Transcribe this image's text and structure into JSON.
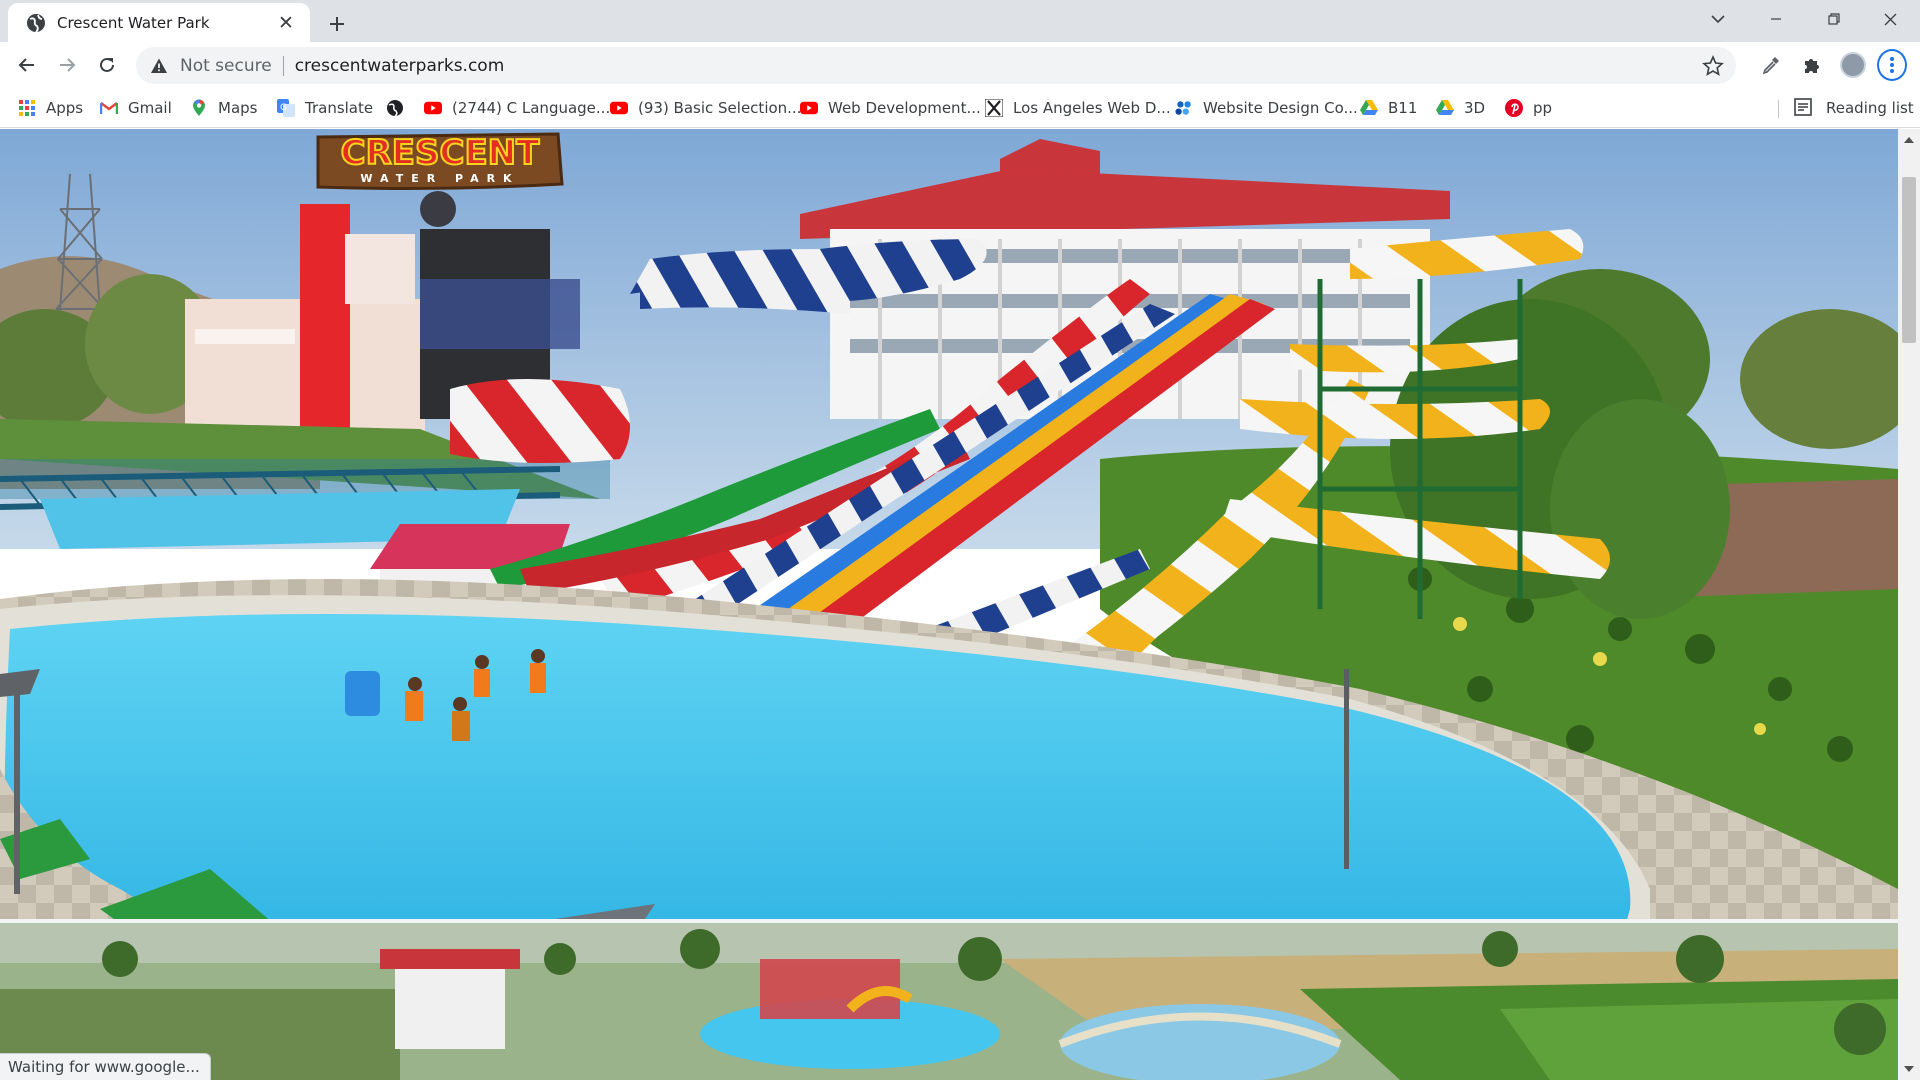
{
  "window": {
    "tab_title": "Crescent Water Park",
    "controls": [
      "tab-search",
      "minimize",
      "restore",
      "close"
    ]
  },
  "toolbar": {
    "security_label": "Not secure",
    "url": "crescentwaterparks.com"
  },
  "bookmarks": [
    {
      "label": "Apps",
      "icon": "apps-grid-icon"
    },
    {
      "label": "Gmail",
      "icon": "gmail-icon"
    },
    {
      "label": "Maps",
      "icon": "maps-pin-icon"
    },
    {
      "label": "Translate",
      "icon": "translate-icon"
    },
    {
      "label": "",
      "icon": "globe-icon"
    },
    {
      "label": "(2744) C Language...",
      "icon": "youtube-icon"
    },
    {
      "label": "(93) Basic Selection...",
      "icon": "youtube-icon"
    },
    {
      "label": "Web Development...",
      "icon": "youtube-icon"
    },
    {
      "label": "Los Angeles Web D...",
      "icon": "x-icon"
    },
    {
      "label": "Website Design Co...",
      "icon": "dots-icon"
    },
    {
      "label": "B11",
      "icon": "drive-icon"
    },
    {
      "label": "3D",
      "icon": "drive-icon"
    },
    {
      "label": "pp",
      "icon": "pinterest-icon"
    }
  ],
  "reading_list": "Reading list",
  "page": {
    "logo_main": "CRESCENT",
    "logo_sub": "WATER PARK",
    "colors": {
      "sky": "#8fb5d9",
      "pool": "#33bde8",
      "grass": "#4f8a2a",
      "roof": "#c8353a",
      "slide_yellow": "#f2b21b",
      "slide_red": "#d8262c"
    }
  },
  "status": "Waiting for www.google..."
}
